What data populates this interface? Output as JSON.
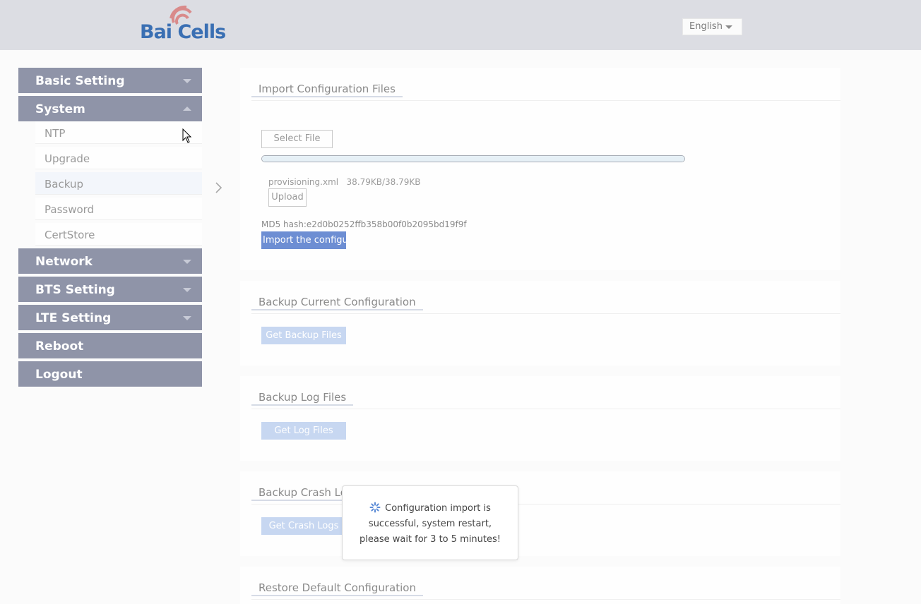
{
  "header": {
    "logo_text": "Bai Cells",
    "language": "English"
  },
  "sidebar": {
    "items": [
      {
        "label": "Basic Setting",
        "state": "collapsed"
      },
      {
        "label": "System",
        "state": "expanded",
        "children": [
          "NTP",
          "Upgrade",
          "Backup",
          "Password",
          "CertStore"
        ],
        "active_child": "Backup"
      },
      {
        "label": "Network",
        "state": "collapsed"
      },
      {
        "label": "BTS Setting",
        "state": "collapsed"
      },
      {
        "label": "LTE Setting",
        "state": "collapsed"
      },
      {
        "label": "Reboot"
      },
      {
        "label": "Logout"
      }
    ]
  },
  "import_panel": {
    "title": "Import Configuration Files",
    "select_file_label": "Select File",
    "progress": 1.0,
    "file_name": "provisioning.xml",
    "file_size": "38.79KB/38.79KB",
    "upload_label": "Upload",
    "md5": "MD5 hash:e2d0b0252ffb358b00f0b2095bd19f9f",
    "import_label": "Import the configuration"
  },
  "backup_current": {
    "title": "Backup Current Configuration",
    "button": "Get Backup Files"
  },
  "backup_log": {
    "title": "Backup Log Files",
    "button": "Get Log Files"
  },
  "backup_crash": {
    "title": "Backup Crash Logs",
    "button": "Get Crash Logs"
  },
  "restore_default": {
    "title": "Restore Default Configuration"
  },
  "toast": {
    "message": "Configuration import is successful, system restart, please wait for 3 to 5 minutes!"
  },
  "colors": {
    "header_bg": "#dcdde3",
    "menu_bg": "#8f94a8",
    "button_light_blue": "#c7d7f1",
    "button_blue": "#6d8ed3"
  }
}
